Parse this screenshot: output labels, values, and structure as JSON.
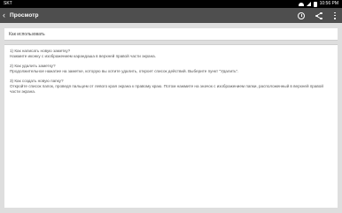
{
  "status_bar": {
    "carrier": "SKT",
    "time": "10:56 PM"
  },
  "app_bar": {
    "title": "Просмотр",
    "icons": [
      "back-icon",
      "alarm-icon",
      "share-icon",
      "overflow-menu-icon"
    ]
  },
  "note": {
    "title": "Как использовать",
    "items": [
      {
        "question": "1) Как написать новую заметку?",
        "answer": "Нажмите иконку с изображением карандаша в верхней правой части экрана."
      },
      {
        "question": "2) Как удалить заметку?",
        "answer": "Продолжительное нажатие на заметке, которую вы хотите удалить, откроет список действий. Выберите пункт \"Удалить\"."
      },
      {
        "question": "3) Как создать новую папку?",
        "answer": "Откройте список папок, проведя пальцем от левого края экрана к правому краю. Потом нажмите на значок с изображением папки, расположенный в верхней правой части экрана."
      }
    ]
  }
}
